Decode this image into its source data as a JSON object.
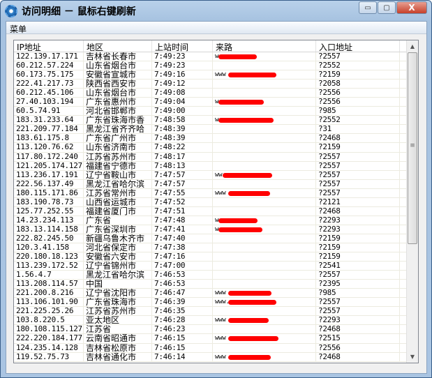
{
  "window": {
    "title": "访问明细 － 鼠标右键刷新",
    "minimize": "▭",
    "maximize": "▢",
    "close": "X"
  },
  "menu": {
    "label": "菜单"
  },
  "columns": [
    "IP地址",
    "地区",
    "上站时间",
    "来路",
    "入口地址"
  ],
  "rows": [
    [
      "122.139.17.171",
      "吉林省长春市",
      "7:49:23",
      "w",
      "?2557"
    ],
    [
      "60.212.57.224",
      "山东省烟台市",
      "7:49:23",
      "",
      "?2552"
    ],
    [
      "60.173.75.175",
      "安徽省宣城市",
      "7:49:16",
      "www",
      "?2159"
    ],
    [
      "222.41.217.73",
      "陕西省西安市",
      "7:49:12",
      "",
      "?2058"
    ],
    [
      "60.212.45.106",
      "山东省烟台市",
      "7:49:08",
      "",
      "?2556"
    ],
    [
      "27.40.103.194",
      "广东省惠州市",
      "7:49:04",
      "w",
      "?2556"
    ],
    [
      "60.5.74.91",
      "河北省邯郸市",
      "7:49:00",
      "",
      "?985"
    ],
    [
      "183.31.233.64",
      "广东省珠海市香",
      "7:48:58",
      "w",
      "?2552"
    ],
    [
      "221.209.77.184",
      "黑龙江省齐齐哈",
      "7:48:39",
      "",
      "?31"
    ],
    [
      "183.61.175.8",
      "广东省广州市",
      "7:48:39",
      "",
      "?2468"
    ],
    [
      "113.120.76.62",
      "山东省济南市",
      "7:48:22",
      "",
      "?2159"
    ],
    [
      "117.80.172.240",
      "江苏省苏州市",
      "7:48:17",
      "",
      "?2557"
    ],
    [
      "121.205.174.127",
      "福建省宁德市",
      "7:48:13",
      "",
      "?2557"
    ],
    [
      "113.236.17.191",
      "辽宁省鞍山市",
      "7:47:57",
      "ww             m",
      "?2557"
    ],
    [
      "222.56.137.49",
      "黑龙江省哈尔滨",
      "7:47:57",
      "",
      "?2557"
    ],
    [
      "180.115.171.86",
      "江苏省常州市",
      "7:47:55",
      "www          om",
      "?2557"
    ],
    [
      "183.190.78.73",
      "山西省运城市",
      "7:47:52",
      "",
      "?2121"
    ],
    [
      "125.77.252.55",
      "福建省厦门市",
      "7:47:51",
      "",
      "?2468"
    ],
    [
      "14.23.234.113",
      "广东省",
      "7:47:48",
      "w",
      "?2293"
    ],
    [
      "183.13.114.158",
      "广东省深圳市",
      "7:47:41",
      "w           om",
      "?2293"
    ],
    [
      "222.82.245.50",
      "新疆乌鲁木齐市",
      "7:47:40",
      "",
      "?2159"
    ],
    [
      "120.3.41.158",
      "河北省保定市",
      "7:47:38",
      "",
      "?2159"
    ],
    [
      "220.180.18.123",
      "安徽省六安市",
      "7:47:16",
      "",
      "?2159"
    ],
    [
      "113.239.172.52",
      "辽宁省锦州市",
      "7:47:00",
      "",
      "?2541"
    ],
    [
      "1.56.4.7",
      "黑龙江省哈尔滨",
      "7:46:53",
      "",
      "?2557"
    ],
    [
      "113.208.114.57",
      "中国",
      "7:46:53",
      "",
      "?2395"
    ],
    [
      "221.200.8.216",
      "辽宁省沈阳市",
      "7:46:47",
      "www",
      "?985"
    ],
    [
      "113.106.101.90",
      "广东省珠海市",
      "7:46:39",
      "www.           m",
      "?2557"
    ],
    [
      "221.225.25.26",
      "江苏省苏州市",
      "7:46:35",
      "",
      "?2557"
    ],
    [
      "103.8.220.5",
      "亚太地区",
      "7:46:28",
      "www           om",
      "?2293"
    ],
    [
      "180.108.115.127",
      "江苏省",
      "7:46:23",
      "",
      "?2468"
    ],
    [
      "222.220.184.177",
      "云南省昭通市",
      "7:46:15",
      "www          om",
      "?2515"
    ],
    [
      "124.235.14.128",
      "吉林省松原市",
      "7:46:15",
      "",
      "?2556"
    ],
    [
      "119.52.75.73",
      "吉林省通化市",
      "7:46:14",
      "www          om",
      "?2468"
    ]
  ],
  "scrollbar": {
    "up": "▲",
    "down": "▼",
    "grip": "≡"
  },
  "colors": {
    "redaction": "#ff0000",
    "frame": "#a9c4e2"
  }
}
